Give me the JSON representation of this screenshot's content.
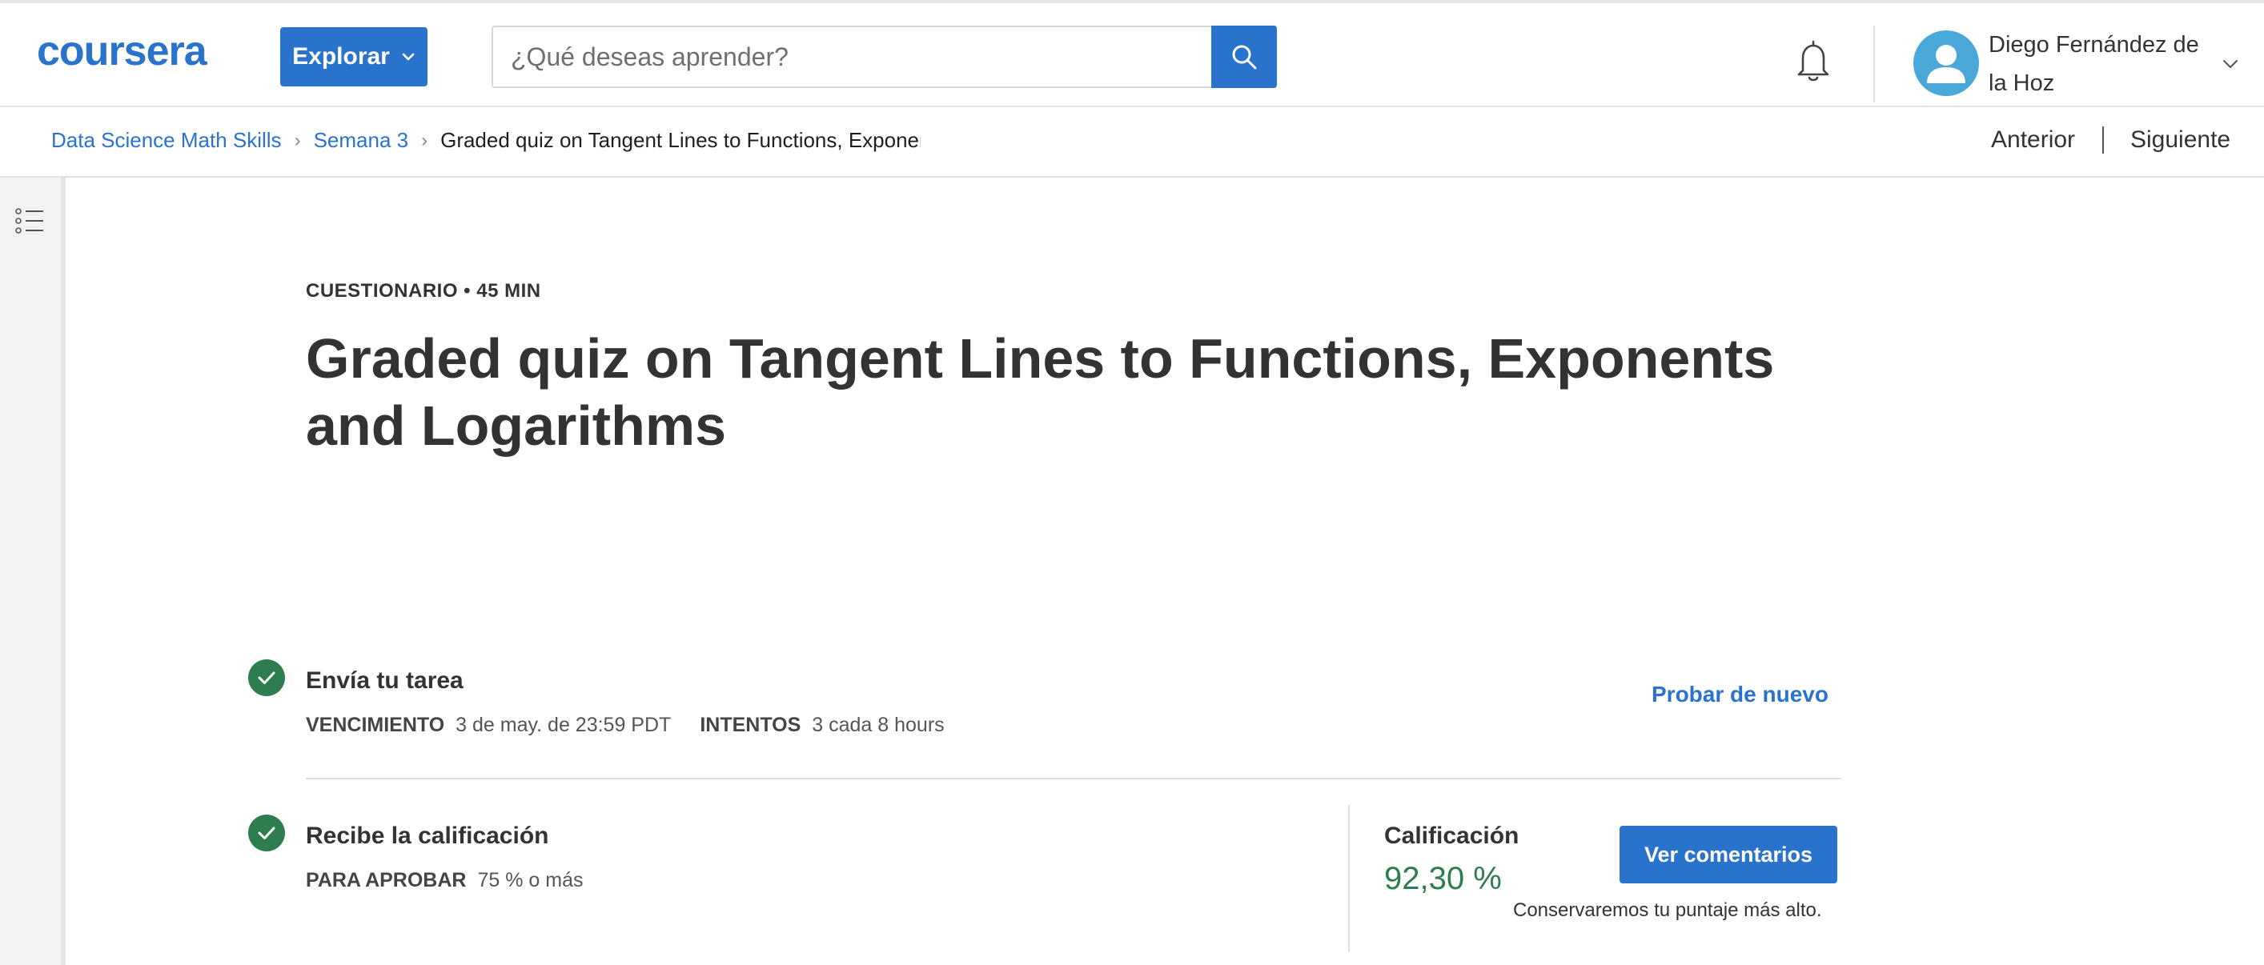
{
  "header": {
    "logo_text": "coursera",
    "explore_label": "Explorar",
    "search_placeholder": "¿Qué deseas aprender?",
    "search_icon": "search-icon",
    "notification_icon": "bell-icon",
    "user_name": "Diego Fernández de la Hoz",
    "accent_color": "#2a73cc"
  },
  "breadcrumb": {
    "items": [
      "Data Science Math Skills",
      "Semana 3"
    ],
    "current": "Graded quiz on Tangent Lines to Functions, Exponents and Logarithms"
  },
  "nav": {
    "previous": "Anterior",
    "next": "Siguiente"
  },
  "sidebar": {
    "toggle_icon": "list-icon"
  },
  "quiz": {
    "meta": "CUESTIONARIO • 45 MIN",
    "title": "Graded quiz on Tangent Lines to Functions, Exponents and Logarithms"
  },
  "submit": {
    "title": "Envía tu tarea",
    "due_label": "VENCIMIENTO",
    "due_value": "3 de may. de 23:59 PDT",
    "attempts_label": "INTENTOS",
    "attempts_value": "3 cada 8 hours",
    "retry_label": "Probar de nuevo"
  },
  "grade": {
    "title": "Recibe la calificación",
    "pass_label": "PARA APROBAR",
    "pass_value": "75 % o más",
    "label": "Calificación",
    "value": "92,30 %",
    "feedback_button": "Ver comentarios",
    "note": "Conservaremos tu puntaje más alto.",
    "status_color": "#2e7d4f"
  }
}
